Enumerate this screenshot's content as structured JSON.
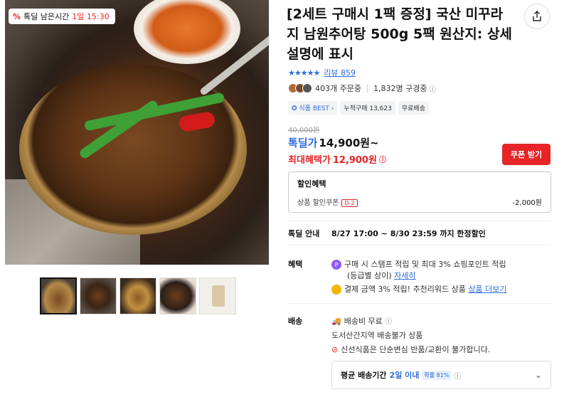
{
  "timer": {
    "label": "톡딜 남은시간",
    "time": "1일 15:30"
  },
  "product": {
    "title": "[2세트 구매시 1팩 증정] 국산 미꾸라지 남원추어탕 500g 5팩 원산지: 상세설명에 표시",
    "rating_stars": "★★★★★",
    "review_label": "리뷰 859",
    "orders": "403개 주문중",
    "subscribers": "1,832명 구경중",
    "chips": [
      "식품 BEST",
      "누적구매 13,623",
      "무료배송"
    ],
    "original_price": "40,000원",
    "price_label": "톡딜가",
    "price": "14,900원~",
    "max_label": "최대혜택가",
    "max_price": "12,900원",
    "coupon_button": "쿠폰 받기"
  },
  "discount": {
    "header": "할인혜택",
    "row_label": "상품 할인쿠폰",
    "badge": "D-2",
    "amount": "-2,000원"
  },
  "talkdeal": {
    "label": "톡딜 안내",
    "text": "8/27 17:00 ~ 8/30 23:59 까지 한정할인"
  },
  "benefit": {
    "label": "혜택",
    "line1": "구매 시 스탬프 적립 및 최대 3% 쇼핑포인트 적립",
    "line1b": "(등급별 상이)",
    "line1_link": "자세히",
    "line2": "결제 금액 3% 적립! 추천리워드 상품",
    "line2_link": "상품 더보기"
  },
  "shipping": {
    "label": "배송",
    "free": "배송비 무료",
    "restriction": "도서산간지역 배송불가 상품",
    "no_return": "신선식품은 단순변심 반품/교환이 불가합니다.",
    "avg_label": "평균 배송기간",
    "avg_value": "2일 이내",
    "avg_pct": "확률 81%"
  },
  "colors": {
    "accent_blue": "#2d6cdf",
    "accent_red": "#e52528"
  }
}
